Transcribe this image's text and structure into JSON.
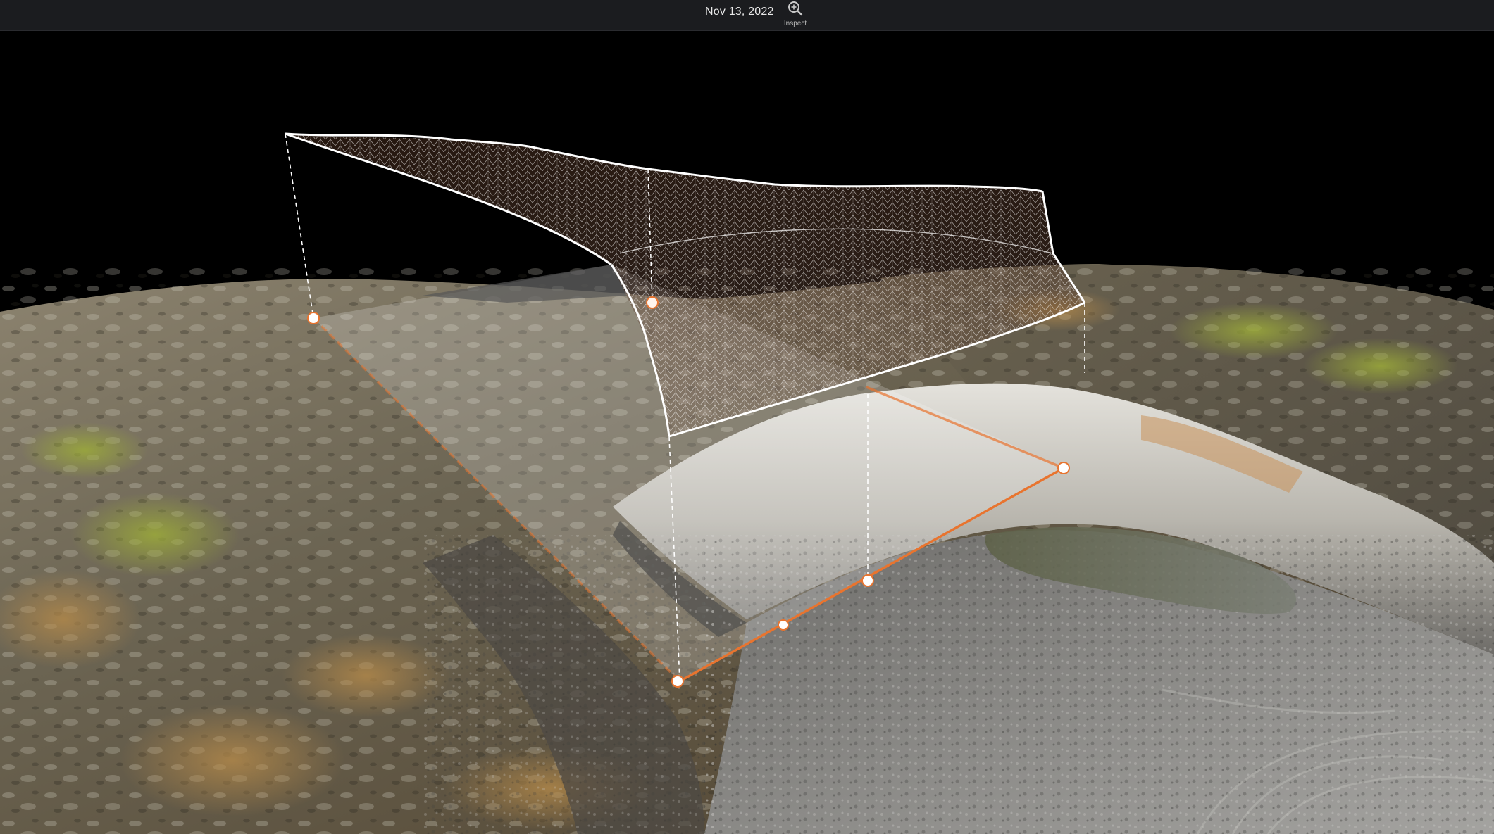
{
  "toolbar": {
    "date": "Nov 13, 2022",
    "inspect_label": "Inspect",
    "inspect_icon": "zoom-in-icon"
  },
  "viewport": {
    "scene": "3d-terrain-model",
    "measurement_tool": "volume",
    "colors": {
      "measure_line": "#e8742f",
      "mesh_wire": "#ffffff",
      "background": "#000000",
      "toolbar": "#1b1c1f"
    }
  }
}
